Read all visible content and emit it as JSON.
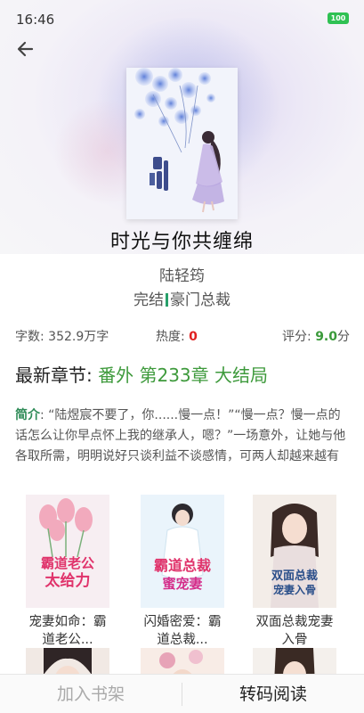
{
  "status_bar": {
    "time": "16:46",
    "battery": "100"
  },
  "book": {
    "title": "时光与你共缠绵",
    "author": "陆轻筠",
    "status": "完结",
    "category": "豪门总裁",
    "cover_title": "时光与你共缠绵"
  },
  "stats": {
    "words_label": "字数: ",
    "words_value": "352.9万字",
    "heat_label": "热度: ",
    "heat_value": "0",
    "score_label": "评分: ",
    "score_value": "9.0",
    "score_unit": "分"
  },
  "latest": {
    "label": "最新章节: ",
    "chapter": "番外 第233章 大结局"
  },
  "intro": {
    "label": "简介",
    "text": ": “陆煜宸不要了，你......慢一点！”“慢一点？慢一点的话怎么让你早点怀上我的继承人，嗯？”一场意外，让她与他各取所需，明明说好只谈利益不谈感情，可两人却越来越有假戏真做的嫌疑。“陆..."
  },
  "recommendations": [
    {
      "name": "宠妻如命：霸道老公...",
      "cover_text": "霸道老公太给力"
    },
    {
      "name": "闪婚密爱：霸道总裁...",
      "cover_text": "霸道总裁蜜宠妻"
    },
    {
      "name": "双面总裁宠妻入骨",
      "cover_text": "双面总裁宠妻入骨"
    }
  ],
  "bottom": {
    "add_shelf": "加入书架",
    "transcode_read": "转码阅读"
  },
  "colors": {
    "accent_green": "#3e9a3c",
    "heat_red": "#e02020",
    "battery_green": "#2fc153"
  }
}
